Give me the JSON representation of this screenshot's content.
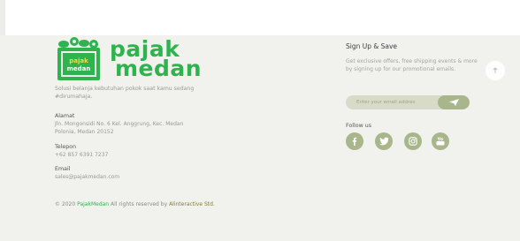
{
  "brand": {
    "name_line1": "pajak",
    "name_line2": "medan",
    "bag_text_top": "pajak",
    "bag_text_bottom": "medan",
    "color_green": "#2eb34f",
    "color_olive": "#a9b58b"
  },
  "footer_left": {
    "tagline": "Solusi belanja kebutuhan pokok saat kamu sedang #dirumahaja.",
    "address_label": "Alamat",
    "address_value": "Jln. Mongonsidi No. 6 Kel. Anggrung, Kec. Medan Polonia, Medan 20152",
    "phone_label": "Telepon",
    "phone_value": "+62 857 6391 7237",
    "email_label": "Email",
    "email_value": "sales@pajakmedan.com",
    "copyright_prefix": "© 2020",
    "copyright_brand": "PajakMedan",
    "copyright_middle": "All rights reserved by",
    "copyright_maker": "Alinteractive Std."
  },
  "signup": {
    "title": "Sign Up & Save",
    "description": "Get exclusive offers, free shipping events & more by signing up for our promotional emails.",
    "email_placeholder": "Enter your email addres",
    "send_icon": "paper-plane-icon"
  },
  "follow": {
    "label": "Follow us",
    "icons": [
      "facebook-icon",
      "twitter-icon",
      "instagram-icon",
      "youtube-icon"
    ]
  },
  "scroll_top_icon": "arrow-up-icon"
}
